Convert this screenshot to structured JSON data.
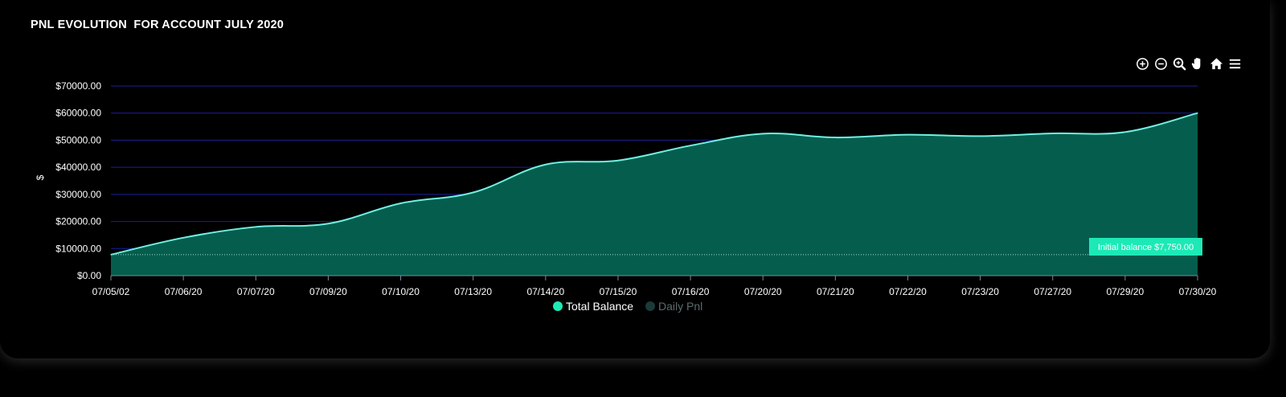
{
  "chart_data": {
    "type": "area",
    "title": "PNL EVOLUTION  FOR ACCOUNT JULY 2020",
    "ylabel": "$",
    "xlabel": "",
    "categories": [
      "07/05/02",
      "07/06/20",
      "07/07/20",
      "07/09/20",
      "07/10/20",
      "07/13/20",
      "07/14/20",
      "07/15/20",
      "07/16/20",
      "07/20/20",
      "07/21/20",
      "07/22/20",
      "07/23/20",
      "07/27/20",
      "07/29/20",
      "07/30/20"
    ],
    "series": [
      {
        "name": "Total Balance",
        "color": "#1de9b6",
        "values": [
          7750,
          14000,
          18000,
          19200,
          26700,
          30700,
          41000,
          42500,
          48000,
          52400,
          51000,
          52000,
          51500,
          52500,
          53000,
          60000
        ]
      },
      {
        "name": "Daily Pnl",
        "color": "#1c3a3a",
        "values": []
      }
    ],
    "ylim": [
      0,
      70000
    ],
    "yticks": [
      0,
      10000,
      20000,
      30000,
      40000,
      50000,
      60000,
      70000
    ],
    "ytick_labels": [
      "$0.00",
      "$10000.00",
      "$20000.00",
      "$30000.00",
      "$40000.00",
      "$50000.00",
      "$60000.00",
      "$70000.00"
    ],
    "grid": true,
    "legend_position": "bottom-center",
    "annotation": {
      "label": "Initial balance $7,750.00",
      "value": 7750
    }
  },
  "colors": {
    "fill": "#055e4d",
    "line": "#6ff0e3",
    "grid": "#1a1f9c",
    "badge": "#1de9b6"
  },
  "toolbar": {
    "icons": [
      "zoom-in-icon",
      "zoom-out-icon",
      "selection-zoom-icon",
      "pan-hand-icon",
      "home-reset-icon",
      "menu-icon"
    ]
  }
}
